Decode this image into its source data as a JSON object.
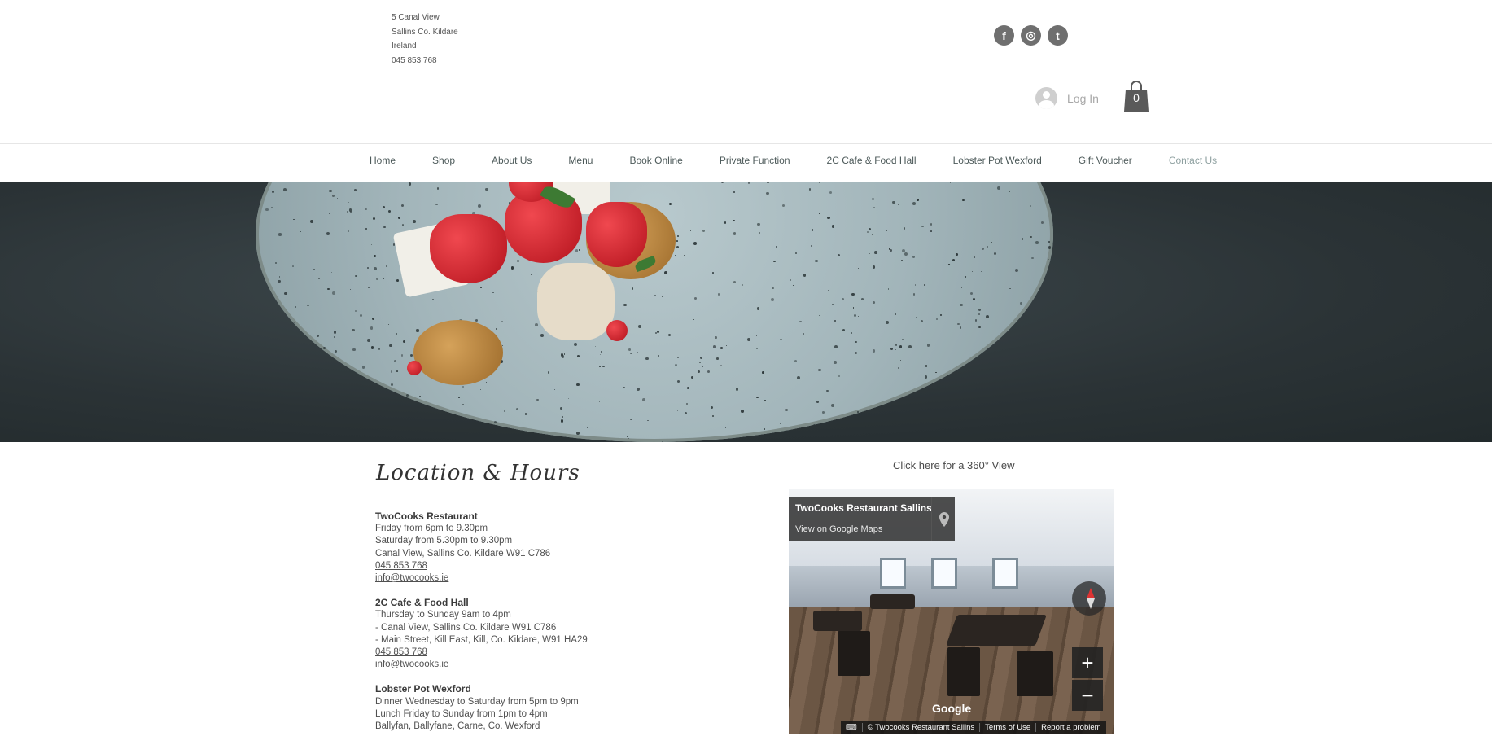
{
  "address": {
    "line1": "5 Canal View",
    "line2": "Sallins Co. Kildare",
    "line3": "Ireland",
    "phone": "045 853 768"
  },
  "social": {
    "facebook": "f",
    "instagram": "◎",
    "twitter": "t"
  },
  "login": {
    "label": "Log In"
  },
  "cart": {
    "count": "0"
  },
  "nav": {
    "items": [
      "Home",
      "Shop",
      "About Us",
      "Menu",
      "Book Online",
      "Private Function",
      "2C Cafe & Food Hall",
      "Lobster Pot Wexford",
      "Gift Voucher",
      "Contact Us"
    ],
    "active": "Contact Us"
  },
  "location": {
    "title": "Location & Hours",
    "venues": [
      {
        "name": "TwoCooks Restaurant",
        "lines": [
          "Friday from 6pm to 9.30pm",
          "Saturday from 5.30pm to 9.30pm",
          "Canal View, Sallins Co. Kildare W91 C786"
        ],
        "phone": "045 853 768",
        "email": "info@twocooks.ie"
      },
      {
        "name": "2C Cafe & Food Hall",
        "lines": [
          "Thursday to Sunday 9am to 4pm",
          "- Canal View, Sallins Co. Kildare W91 C786",
          "- Main Street, Kill East, Kill, Co. Kildare, W91 HA29"
        ],
        "phone": "045 853 768",
        "email": "info@twocooks.ie"
      },
      {
        "name": "Lobster Pot Wexford",
        "lines": [
          "Dinner Wednesday to Saturday from 5pm to 9pm",
          "Lunch Friday to Sunday from 1pm to 4pm",
          "Ballyfan, Ballyfane, Carne, Co. Wexford"
        ]
      }
    ]
  },
  "view360": {
    "label": "Click here for a 360° View"
  },
  "map": {
    "card_title": "TwoCooks Restaurant Sallins",
    "card_link": "View on Google Maps",
    "google": "Google",
    "footer": {
      "copyright": "© Twocooks Restaurant Sallins",
      "terms": "Terms of Use",
      "report": "Report a problem"
    }
  },
  "colors": {
    "nav_text": "#4d5a5a",
    "nav_active": "#8ea0a0",
    "hero_bg": "#2b3336",
    "plate": "#a2b5ba"
  }
}
